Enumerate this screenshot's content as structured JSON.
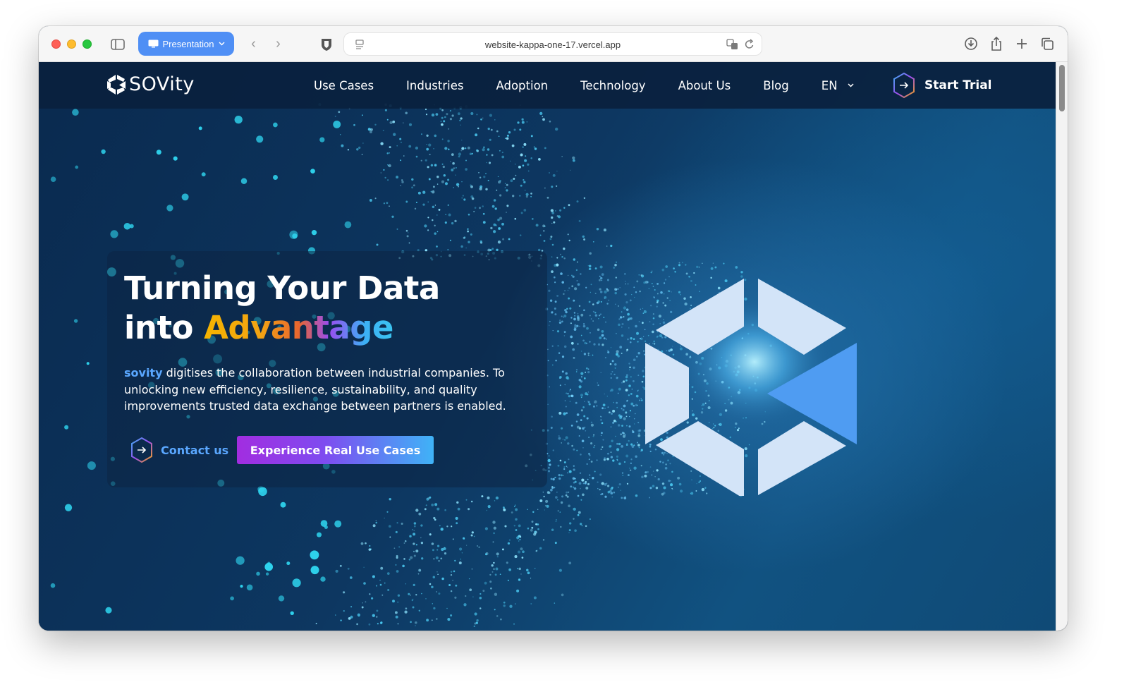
{
  "browser": {
    "presentation_label": "Presentation",
    "url": "website-kappa-one-17.vercel.app"
  },
  "nav": {
    "logo_text": "SOVity",
    "links": [
      "Use Cases",
      "Industries",
      "Adoption",
      "Technology",
      "About Us",
      "Blog"
    ],
    "language": "EN",
    "start_trial": "Start Trial"
  },
  "hero": {
    "title_line1": "Turning Your Data",
    "title_line2_prefix": "into ",
    "title_highlight": "Advantage",
    "brand_word": "sovity",
    "description": " digitises the collaboration between industrial companies. To unlocking new efficiency, resilience, sustainability, and quality improvements trusted data exchange between partners is enabled.",
    "contact_label": "Contact us",
    "cta_label": "Experience Real Use Cases"
  },
  "colors": {
    "accent_blue": "#5aa7ff",
    "cta_start": "#a22de0",
    "cta_end": "#3fb3f7",
    "nav_bg": "#0a213e"
  }
}
